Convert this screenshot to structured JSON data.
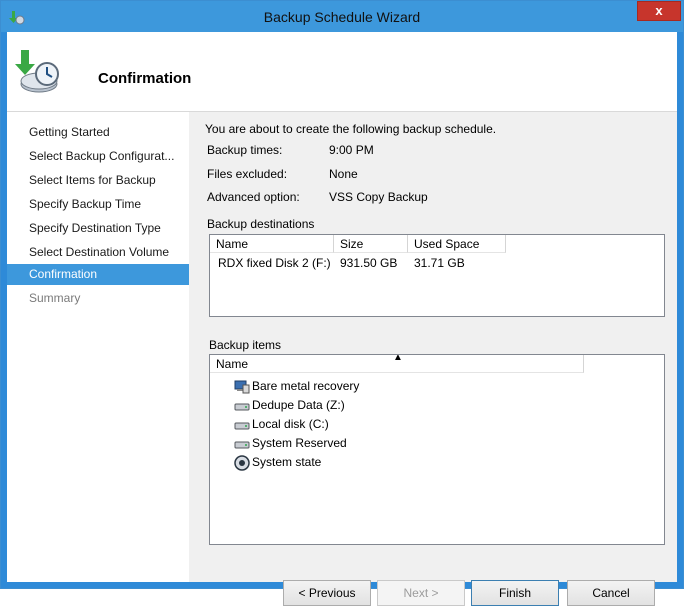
{
  "window": {
    "title": "Backup Schedule Wizard",
    "close_label": "x"
  },
  "header": {
    "page_title": "Confirmation"
  },
  "steps": [
    {
      "label": "Getting Started",
      "state": "normal"
    },
    {
      "label": "Select Backup Configurat...",
      "state": "normal"
    },
    {
      "label": "Select Items for Backup",
      "state": "normal"
    },
    {
      "label": "Specify Backup Time",
      "state": "normal"
    },
    {
      "label": "Specify Destination Type",
      "state": "normal"
    },
    {
      "label": "Select Destination Volume",
      "state": "normal"
    },
    {
      "label": "Confirmation",
      "state": "active"
    },
    {
      "label": "Summary",
      "state": "disabled"
    }
  ],
  "summary": {
    "intro": "You are about to create the following backup schedule.",
    "rows": [
      {
        "label": "Backup times:",
        "value": "9:00 PM"
      },
      {
        "label": "Files excluded:",
        "value": "None"
      },
      {
        "label": "Advanced option:",
        "value": "VSS Copy Backup"
      }
    ]
  },
  "destinations": {
    "title": "Backup destinations",
    "columns": [
      "Name",
      "Size",
      "Used Space"
    ],
    "rows": [
      [
        "RDX fixed Disk 2 (F:)",
        "931.50 GB",
        "31.71 GB"
      ]
    ]
  },
  "items": {
    "title": "Backup items",
    "column": "Name",
    "sort_indicator": "▲",
    "entries": [
      {
        "label": "Bare metal recovery",
        "icon": "bare-metal-icon"
      },
      {
        "label": "Dedupe Data (Z:)",
        "icon": "drive-icon"
      },
      {
        "label": "Local disk (C:)",
        "icon": "drive-icon"
      },
      {
        "label": "System Reserved",
        "icon": "drive-icon"
      },
      {
        "label": "System state",
        "icon": "system-state-icon"
      }
    ]
  },
  "buttons": {
    "previous": "< Previous",
    "next": "Next >",
    "finish": "Finish",
    "cancel": "Cancel"
  },
  "colors": {
    "accent": "#3d98dc",
    "close": "#c7352c",
    "panel": "#f0f0f0"
  }
}
